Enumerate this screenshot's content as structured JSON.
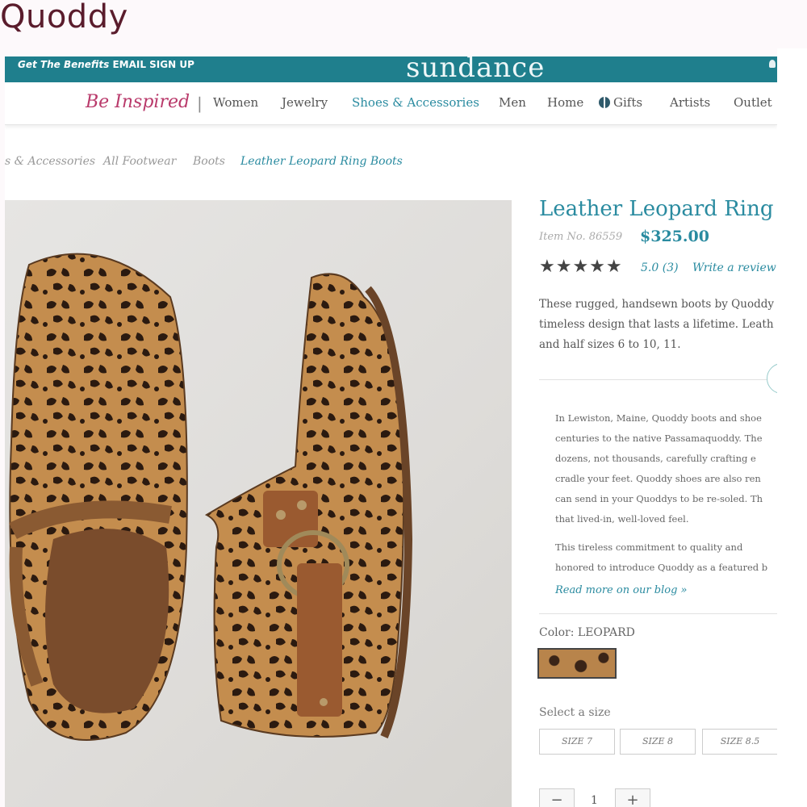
{
  "caption": "Quoddy",
  "header": {
    "promo_lead": "Get The Benefits",
    "promo_link": "EMAIL SIGN UP",
    "logo": "sundance",
    "tagline": "Be Inspired",
    "separator": "|",
    "nav": [
      "Women",
      "Jewelry",
      "Shoes & Accessories",
      "Men",
      "Home",
      "Gifts",
      "Artists",
      "Outlet"
    ],
    "active_nav": "Shoes & Accessories"
  },
  "breadcrumb": [
    "s & Accessories",
    "All Footwear",
    "Boots",
    "Leather Leopard Ring Boots"
  ],
  "product": {
    "title": "Leather Leopard Ring B",
    "item_no": "Item No. 86559",
    "price": "$325.00",
    "stars": "★★★★★",
    "rating": "5.0 (3)",
    "write_review": "Write a review",
    "description": [
      "These rugged, handsewn boots by Quoddy",
      "timeless design that lasts a lifetime. Leath",
      "and half sizes 6 to 10, 11."
    ],
    "story": [
      "In Lewiston, Maine, Quoddy boots and shoe",
      "centuries to the native Passamaquoddy. The",
      "dozens, not thousands, carefully crafting e",
      "cradle your feet. Quoddy shoes are also ren",
      "can send in your Quoddys to be re-soled. Th",
      "that lived-in, well-loved feel."
    ],
    "story2": [
      "This tireless commitment to quality and",
      "honored to introduce Quoddy as a featured b"
    ],
    "read_more": "Read more on our blog »",
    "color_label": "Color: LEOPARD",
    "size_label": "Select a size",
    "sizes": [
      "SIZE 7",
      "SIZE 8",
      "SIZE 8.5"
    ],
    "qty": "1",
    "qty_minus": "−",
    "qty_plus": "+"
  },
  "colors": {
    "teal": "#1f7f8d",
    "accent": "#2a8ba0",
    "tagline": "#b93a6b",
    "caption": "#5a1c2c"
  },
  "icons": [
    "account-icon",
    "gift-icon",
    "star-icon",
    "leopard-swatch"
  ]
}
